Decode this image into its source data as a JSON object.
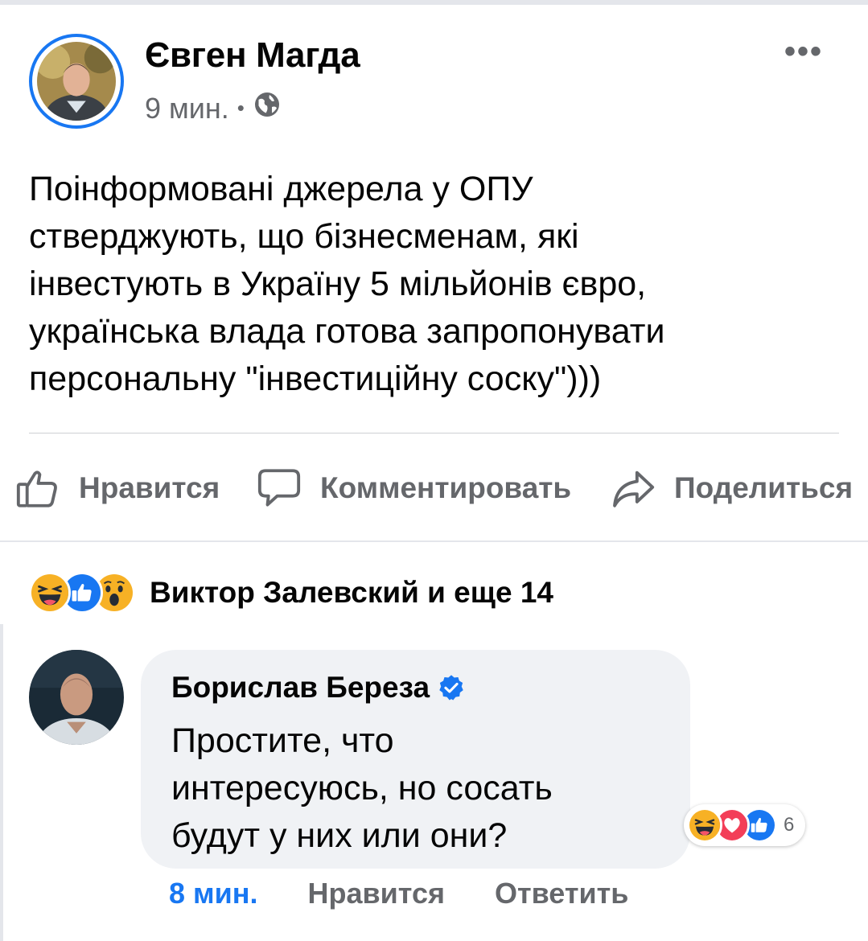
{
  "post": {
    "author": "Євген Магда",
    "time": "9 мин.",
    "separator": "•",
    "text": "Поінформовані джерела у ОПУ\nстверджують, що бізнесменам, які\nінвестують в Україну 5 мільйонів євро,\nукраїнська влада готова запропонувати\nперсональну \"інвестиційну соску\")))",
    "icons": {
      "privacy": "globe-icon",
      "more": "more-dots-icon"
    }
  },
  "actions": {
    "like_label": "Нравится",
    "comment_label": "Комментировать",
    "share_label": "Поделиться"
  },
  "reactions": {
    "types": [
      "haha",
      "like",
      "wow"
    ],
    "summary": "Виктор Залевский и еще 14"
  },
  "comment": {
    "author": "Борислав Береза",
    "verified": true,
    "text": "Простите, что\nинтересуюсь, но сосать\nбудут у них или они?",
    "reaction_types": [
      "haha",
      "love",
      "like"
    ],
    "reaction_count": "6",
    "time": "8 мин.",
    "like_label": "Нравится",
    "reply_label": "Ответить"
  },
  "colors": {
    "accent": "#1877f2",
    "secondary_text": "#65676b",
    "bubble_bg": "#f0f2f5",
    "love": "#f33e58",
    "haha": "#f7b125"
  }
}
